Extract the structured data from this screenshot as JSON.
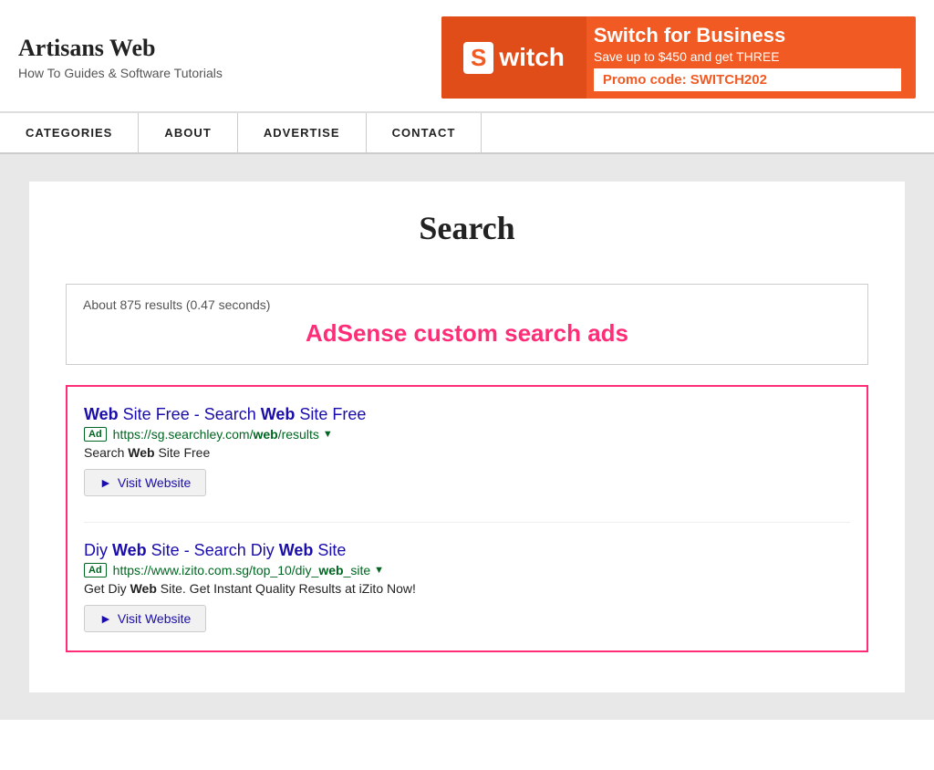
{
  "header": {
    "site_title": "Artisans Web",
    "site_subtitle": "How To Guides & Software Tutorials"
  },
  "banner": {
    "logo_s": "S",
    "logo_text": "witch",
    "main_text": "Switch for Business",
    "sub_text": "Save up to $450 and get THREE",
    "promo": "Promo code: SWITCH202"
  },
  "nav": {
    "items": [
      {
        "label": "CATEGORIES"
      },
      {
        "label": "ABOUT"
      },
      {
        "label": "ADVERTISE"
      },
      {
        "label": "CONTACT"
      }
    ]
  },
  "main": {
    "search_heading": "Search",
    "results_meta": "About 875 results (0.47 seconds)",
    "adsense_label": "AdSense custom search ads",
    "ads": [
      {
        "title_parts": [
          {
            "text": "Web",
            "bold": true
          },
          {
            "text": " Site Free - Search ",
            "bold": false
          },
          {
            "text": "Web",
            "bold": true
          },
          {
            "text": " Site Free",
            "bold": false
          }
        ],
        "title_flat": "Web Site Free - Search Web Site Free",
        "badge": "Ad",
        "url": "https://sg.searchley.com/web/results",
        "desc_parts": [
          {
            "text": "Search ",
            "bold": false
          },
          {
            "text": "Web",
            "bold": true
          },
          {
            "text": " Site Free",
            "bold": false
          }
        ],
        "desc_flat": "Search Web Site Free",
        "visit_label": "Visit Website"
      },
      {
        "title_parts": [
          {
            "text": "Diy ",
            "bold": false
          },
          {
            "text": "Web",
            "bold": true
          },
          {
            "text": " Site - Search Diy ",
            "bold": false
          },
          {
            "text": "Web",
            "bold": true
          },
          {
            "text": " Site",
            "bold": false
          }
        ],
        "title_flat": "Diy Web Site - Search Diy Web Site",
        "badge": "Ad",
        "url": "https://www.izito.com.sg/top_10/diy_web_site",
        "desc_parts": [
          {
            "text": "Get Diy ",
            "bold": false
          },
          {
            "text": "Web",
            "bold": true
          },
          {
            "text": " Site. Get Instant Quality Results at iZito Now!",
            "bold": false
          }
        ],
        "desc_flat": "Get Diy Web Site. Get Instant Quality Results at iZito Now!",
        "visit_label": "Visit Website"
      }
    ]
  }
}
